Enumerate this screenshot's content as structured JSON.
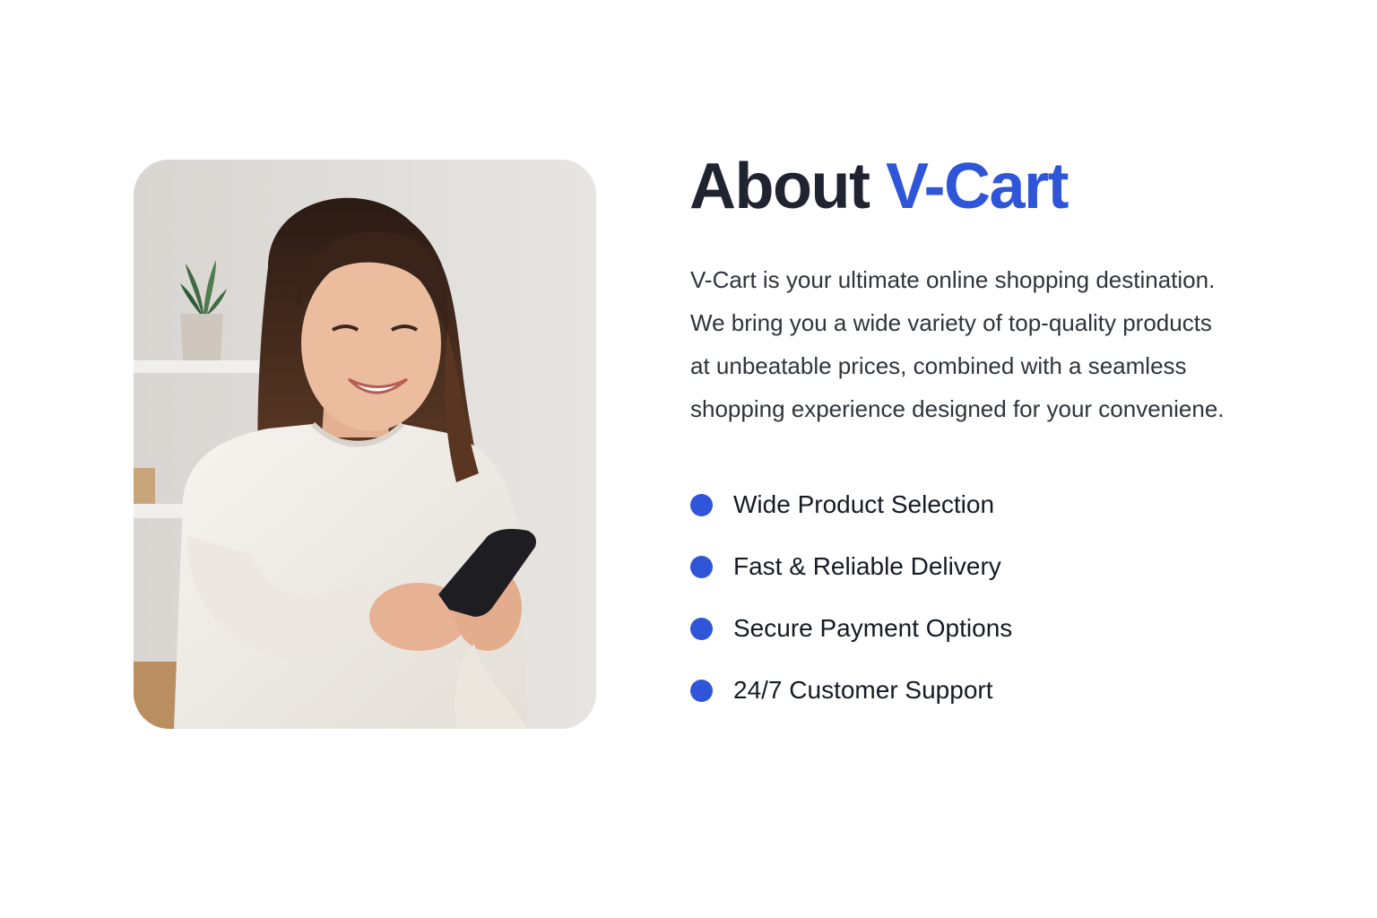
{
  "about": {
    "title_prefix": "About",
    "title_brand": "V-Cart",
    "description_lines": [
      "V-Cart is your ultimate online shopping destination.",
      "We bring you a wide variety of top-quality products",
      "at unbeatable prices, combined with a seamless",
      "shopping experience designed for your conveniene."
    ],
    "features": [
      "Wide Product Selection",
      "Fast & Reliable Delivery",
      "Secure Payment Options",
      "24/7 Customer Support"
    ]
  },
  "colors": {
    "accent": "#2f55d8",
    "heading": "#1f2430",
    "body_text": "#2f333b",
    "background": "#ffffff"
  },
  "image": {
    "subject": "woman-smiling-using-smartphone-photo"
  }
}
